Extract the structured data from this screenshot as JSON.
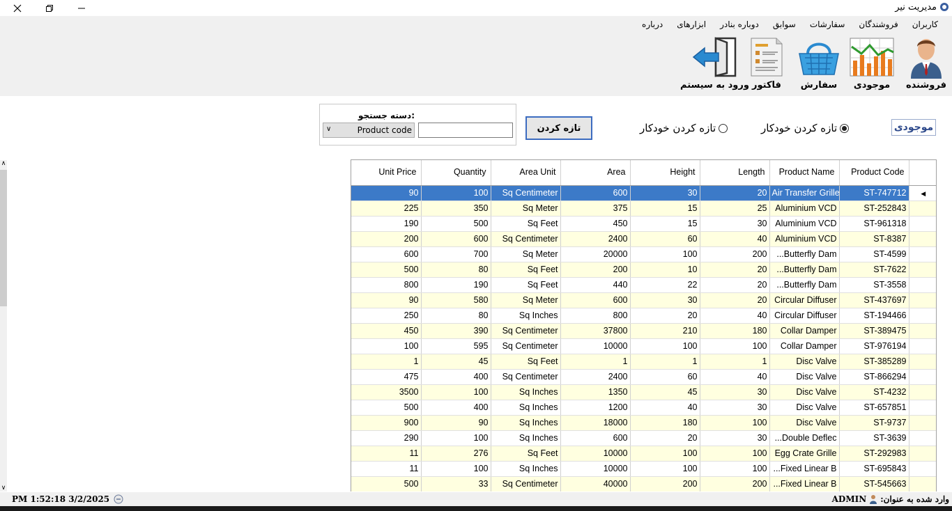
{
  "window": {
    "title": "مدیریت نیر"
  },
  "menu": [
    "کاربران",
    "فروشندگان",
    "سفارشات",
    "سوابق",
    "دوباره بنادر",
    "ابزارهای",
    "درباره"
  ],
  "toolbar": [
    {
      "label": "فروشنده",
      "icon": "salesman-icon"
    },
    {
      "label": "موجودی",
      "icon": "inventory-chart-icon"
    },
    {
      "label": "سفارش",
      "icon": "basket-icon"
    },
    {
      "label": "فاکتور",
      "icon": "invoice-icon"
    },
    {
      "label": "ورود به سیستم",
      "icon": "login-door-icon"
    }
  ],
  "page": {
    "title": "موجودی",
    "auto_refresh_on": "تازه کردن خودکار",
    "auto_refresh_off": "تازه کردن خودکار",
    "refresh_button": "تازه کردن",
    "search_label": "دسته جستجو:",
    "search_value": "",
    "search_category": "Product code"
  },
  "grid": {
    "columns": [
      "Product Code",
      "Product Name",
      "Length",
      "Height",
      "Area",
      "Area Unit",
      "Quantity",
      "Unit Price"
    ],
    "rows": [
      [
        "ST-747712",
        "Air Transfer Grille",
        "20",
        "30",
        "600",
        "Sq Centimeter",
        "100",
        "90"
      ],
      [
        "ST-252843",
        "Aluminium VCD",
        "25",
        "15",
        "375",
        "Sq Meter",
        "350",
        "225"
      ],
      [
        "ST-961318",
        "Aluminium VCD",
        "30",
        "15",
        "450",
        "Sq Feet",
        "500",
        "190"
      ],
      [
        "ST-8387",
        "Aluminium VCD",
        "40",
        "60",
        "2400",
        "Sq Centimeter",
        "600",
        "200"
      ],
      [
        "ST-4599",
        "...Butterfly Dam",
        "200",
        "100",
        "20000",
        "Sq Meter",
        "700",
        "600"
      ],
      [
        "ST-7622",
        "...Butterfly Dam",
        "20",
        "10",
        "200",
        "Sq Feet",
        "80",
        "500"
      ],
      [
        "ST-3558",
        "...Butterfly Dam",
        "20",
        "22",
        "440",
        "Sq Feet",
        "190",
        "800"
      ],
      [
        "ST-437697",
        "Circular Diffuser",
        "20",
        "30",
        "600",
        "Sq Meter",
        "580",
        "90"
      ],
      [
        "ST-194466",
        "Circular Diffuser",
        "40",
        "20",
        "800",
        "Sq Inches",
        "80",
        "250"
      ],
      [
        "ST-389475",
        "Collar Damper",
        "180",
        "210",
        "37800",
        "Sq Centimeter",
        "390",
        "450"
      ],
      [
        "ST-976194",
        "Collar Damper",
        "100",
        "100",
        "10000",
        "Sq Centimeter",
        "595",
        "100"
      ],
      [
        "ST-385289",
        "Disc Valve",
        "1",
        "1",
        "1",
        "Sq Feet",
        "45",
        "1"
      ],
      [
        "ST-866294",
        "Disc Valve",
        "40",
        "60",
        "2400",
        "Sq Centimeter",
        "400",
        "475"
      ],
      [
        "ST-4232",
        "Disc Valve",
        "30",
        "45",
        "1350",
        "Sq Inches",
        "100",
        "3500"
      ],
      [
        "ST-657851",
        "Disc Valve",
        "30",
        "40",
        "1200",
        "Sq Inches",
        "400",
        "500"
      ],
      [
        "ST-9737",
        "Disc Valve",
        "100",
        "180",
        "18000",
        "Sq Inches",
        "90",
        "900"
      ],
      [
        "ST-3639",
        "...Double Deflec",
        "30",
        "20",
        "600",
        "Sq Inches",
        "100",
        "290"
      ],
      [
        "ST-292983",
        "Egg Crate Grille",
        "100",
        "100",
        "10000",
        "Sq Feet",
        "276",
        "11"
      ],
      [
        "ST-695843",
        "...Fixed Linear B",
        "100",
        "100",
        "10000",
        "Sq Inches",
        "100",
        "11"
      ],
      [
        "ST-545663",
        "...Fixed Linear B",
        "200",
        "200",
        "40000",
        "Sq Centimeter",
        "33",
        "500"
      ]
    ],
    "selected_row": 0
  },
  "status": {
    "logged_in_label": "وارد شده به عنوان:",
    "user": "ADMIN",
    "datetime": "3/2/2025 1:52:18 PM"
  },
  "colors": {
    "selection": "#3c7ac8",
    "alt_row": "#ffffe0",
    "accent": "#3c6cc0"
  }
}
